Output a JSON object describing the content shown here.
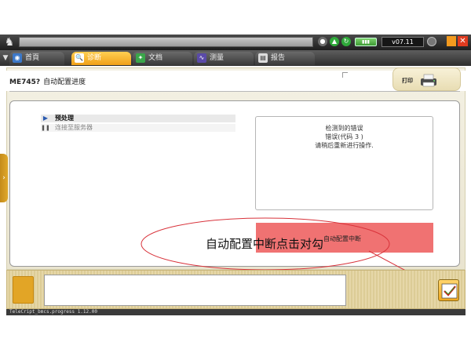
{
  "header": {
    "version": "v07.11",
    "battery_icon": "battery-icon",
    "close_glyph": "✕"
  },
  "tabs": [
    {
      "label": "首頁",
      "icon": "home-icon"
    },
    {
      "label": "诊断",
      "icon": "diagnosis-icon",
      "active": true
    },
    {
      "label": "文档",
      "icon": "document-icon"
    },
    {
      "label": "测量",
      "icon": "measure-icon"
    },
    {
      "label": "报告",
      "icon": "report-icon"
    }
  ],
  "page": {
    "title_code": "ME745?",
    "title_text": "自动配置进度",
    "print_label": "打印"
  },
  "steps": [
    {
      "label": "预处理",
      "state": "current"
    },
    {
      "label": "连接至服务器",
      "state": "pending"
    }
  ],
  "error_panel": {
    "line1": "检测到的错误",
    "line2": "错误(代码 3 )",
    "line3": "请稍后重新进行操作."
  },
  "status_banner": {
    "text": "自动配置中断"
  },
  "annotation": {
    "text": "自动配置中断点击对勾"
  },
  "footer": {
    "text": "TeleCript_bmcs.progress  1.12.00"
  },
  "colors": {
    "accent": "#f0a018",
    "banner": "#f07272",
    "annotation_line": "#d8323a"
  }
}
